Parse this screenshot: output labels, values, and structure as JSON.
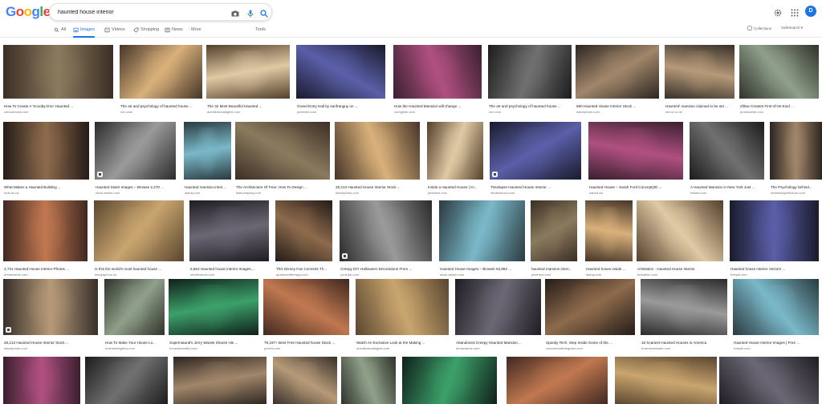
{
  "header": {
    "logo_letters": [
      {
        "ch": "G",
        "color": "#4285F4"
      },
      {
        "ch": "o",
        "color": "#EA4335"
      },
      {
        "ch": "o",
        "color": "#FBBC05"
      },
      {
        "ch": "g",
        "color": "#4285F4"
      },
      {
        "ch": "l",
        "color": "#34A853"
      },
      {
        "ch": "e",
        "color": "#EA4335"
      }
    ],
    "search_value": "haunted house interior",
    "search_icons": [
      "camera-icon",
      "microphone-icon",
      "search-icon"
    ],
    "right_icons": [
      "settings-icon",
      "apps-grid-icon"
    ],
    "avatar_letter": "D",
    "avatar_color": "#1a73e8"
  },
  "tabs": {
    "items": [
      {
        "label": "All",
        "icon": "search-icon",
        "active": false
      },
      {
        "label": "Images",
        "icon": "image-icon",
        "active": true
      },
      {
        "label": "Videos",
        "icon": "video-icon",
        "active": false
      },
      {
        "label": "Shopping",
        "icon": "tag-icon",
        "active": false
      },
      {
        "label": "News",
        "icon": "news-icon",
        "active": false
      },
      {
        "label": ": More",
        "icon": "",
        "active": false
      }
    ],
    "tools": "Tools",
    "collections": "Collections",
    "safesearch": "SafeSearch ▾"
  },
  "accent_color": "#1a73e8",
  "results": [
    [
      {
        "caption": "How To Create A 'Scooby-Doo' Haunted ...",
        "source": "cartoonbrew.com",
        "badge": false
      },
      {
        "caption": "The art and psychology of haunted house ...",
        "source": "cnn.com",
        "badge": false
      },
      {
        "caption": "The 32 Most Beautiful Haunted ...",
        "source": "architecturaldigest.com",
        "badge": false
      },
      {
        "caption": "Grand Entry Hall by sanfranguy on ...",
        "source": "pinterest.com",
        "badge": false
      },
      {
        "caption": "How the Haunted Mansion will change ...",
        "source": "ocregister.com",
        "badge": false
      },
      {
        "caption": "The art and psychology of haunted house ...",
        "source": "cnn.com",
        "badge": false
      },
      {
        "caption": "690 Haunted House Interior Stock ...",
        "source": "istockphoto.com",
        "badge": false
      },
      {
        "caption": "Haunted' mansion claimed to be set ...",
        "source": "mirror.co.uk",
        "badge": false
      },
      {
        "caption": "Zillow Creates First-of-Its-Kind ...",
        "source": "prnewswire.com",
        "badge": false
      }
    ],
    [
      {
        "caption": "What Makes a Haunted Building ...",
        "source": "mde.ac.uk",
        "badge": false
      },
      {
        "caption": "Haunted Stairs Images – Browse 2,270 ...",
        "source": "stock.adobe.com",
        "badge": true
      },
      {
        "caption": "Haunted mansion interi...",
        "source": "alamy.com",
        "badge": false
      },
      {
        "caption": "The Architecture Of Fear: How To Design ...",
        "source": "fastcompany.com",
        "badge": false
      },
      {
        "caption": "28,213 Haunted House Interior Stock ...",
        "source": "istockphoto.com",
        "badge": false
      },
      {
        "caption": "Inside a Haunted House | Cr...",
        "source": "pinterest.com",
        "badge": false
      },
      {
        "caption": "Timelapse Haunted House Interior ...",
        "source": "shutterstock.com",
        "badge": true
      },
      {
        "caption": "Haunted House – Sarah Ford Concept|2D ...",
        "source": "saford.art",
        "badge": false
      },
      {
        "caption": "A Haunted Mansion in New York Just ...",
        "source": "insider.com",
        "badge": false
      },
      {
        "caption": "The Psychology behind...",
        "source": "mrthinkingthefuture.com",
        "badge": false
      }
    ],
    [
      {
        "caption": "2,731 Haunted House Interior Photos ...",
        "source": "dreamstime.com",
        "badge": false
      },
      {
        "caption": "Is this the world's most haunted house ...",
        "source": "telegraph.co.uk",
        "badge": false
      },
      {
        "caption": "5,553 Haunted house interior Images ...",
        "source": "shutterstock.com",
        "badge": false
      },
      {
        "caption": "This Disney Fan Converts Th...",
        "source": "apartmenttherapy.com",
        "badge": false
      },
      {
        "caption": "Creepy DIY Halloween Decorations From ...",
        "source": "youtube.com",
        "badge": true
      },
      {
        "caption": "Haunted House Images – Browse 53,892 ...",
        "source": "stock.adobe.com",
        "badge": false
      },
      {
        "caption": "haunted mansion interi...",
        "source": "pinterest.com",
        "badge": false
      },
      {
        "caption": "Haunted house inside ...",
        "source": "alamy.com",
        "badge": false
      },
      {
        "caption": "ArtStation - Haunted House Interior",
        "source": "artstation.com",
        "badge": false
      },
      {
        "caption": "Haunted house interior Vectors ...",
        "source": "freepik.com",
        "badge": false
      }
    ],
    [
      {
        "caption": "28,213 Haunted House Interior Stock ...",
        "source": "istockphoto.com",
        "badge": true
      },
      {
        "caption": "How To Make Your House Lo...",
        "source": "entertainingdiva.com",
        "badge": false
      },
      {
        "caption": "Supernatural's Jerry Wanek Shares His ...",
        "source": "housebeautiful.com",
        "badge": false
      },
      {
        "caption": "79,187+ Best Free Haunted house Stock ...",
        "source": "pexels.com",
        "badge": false
      },
      {
        "caption": "Watch An Exclusive Look at the Making ...",
        "source": "architecturaldigest.com",
        "badge": false
      },
      {
        "caption": "Abandoned Creepy Haunted Mansion ...",
        "source": "dreamstime.com",
        "badge": false
      },
      {
        "caption": "Spooky Tech: Step Inside Some of the ...",
        "source": "commercialintegrator.com",
        "badge": false
      },
      {
        "caption": "16 Scariest Haunted Houses in America",
        "source": "businessinsider.com",
        "badge": false
      },
      {
        "caption": "Haunted House Interior Images | Free ...",
        "source": "freepik.com",
        "badge": false
      }
    ],
    [
      {
        "caption": "",
        "source": "",
        "badge": false
      },
      {
        "caption": "",
        "source": "",
        "badge": false
      },
      {
        "caption": "",
        "source": "",
        "badge": false
      },
      {
        "caption": "",
        "source": "",
        "badge": false
      },
      {
        "caption": "",
        "source": "",
        "badge": false
      },
      {
        "caption": "",
        "source": "",
        "badge": false
      },
      {
        "caption": "",
        "source": "",
        "badge": false
      },
      {
        "caption": "",
        "source": "",
        "badge": false
      },
      {
        "caption": "",
        "source": "",
        "badge": false
      }
    ]
  ]
}
